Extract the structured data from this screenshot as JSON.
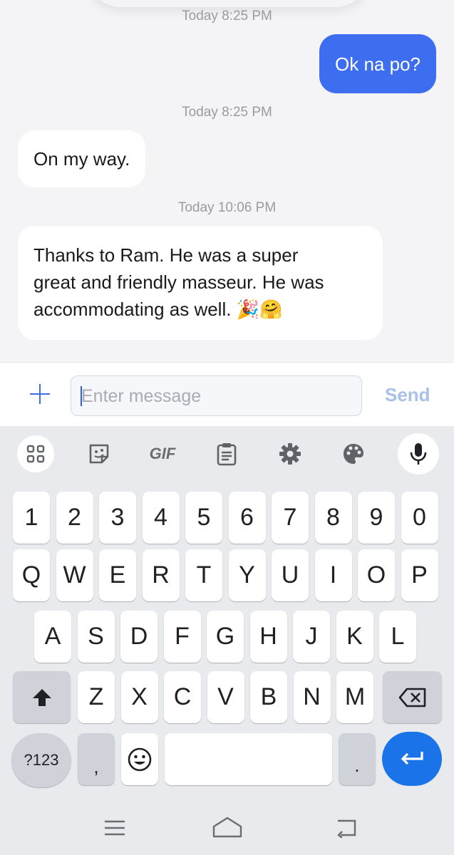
{
  "messages": [
    {
      "timestamp": "Today 8:25 PM",
      "type": "sent",
      "text": "Ok na po?"
    },
    {
      "timestamp": "Today 8:25 PM",
      "type": "received",
      "text": "On my way."
    },
    {
      "timestamp": "Today 10:06 PM",
      "type": "received",
      "lines": [
        "Thanks to Ram. He was a super",
        "great and friendly masseur. He was",
        "accommodating as well. 🎉🤗"
      ]
    }
  ],
  "composer": {
    "placeholder": "Enter message",
    "send_label": "Send"
  },
  "keyboard": {
    "toolbar": {
      "icons": [
        "apps-grid-icon",
        "sticker-icon",
        "gif-icon",
        "clipboard-icon",
        "settings-gear-icon",
        "theme-palette-icon",
        "microphone-icon"
      ],
      "gif_label": "GIF"
    },
    "rows": [
      [
        "1",
        "2",
        "3",
        "4",
        "5",
        "6",
        "7",
        "8",
        "9",
        "0"
      ],
      [
        "Q",
        "W",
        "E",
        "R",
        "T",
        "Y",
        "U",
        "I",
        "O",
        "P"
      ],
      [
        "A",
        "S",
        "D",
        "F",
        "G",
        "H",
        "J",
        "K",
        "L"
      ],
      [
        "Z",
        "X",
        "C",
        "V",
        "B",
        "N",
        "M"
      ]
    ],
    "symbols_label": "?123",
    "comma_label": ",",
    "period_label": "."
  },
  "navbar": {
    "icons": [
      "recent-apps-icon",
      "home-icon",
      "back-icon"
    ]
  },
  "colors": {
    "sent_bubble": "#3d6ef0",
    "send_text": "#a8c0ea",
    "enter_key": "#1a73e8"
  }
}
